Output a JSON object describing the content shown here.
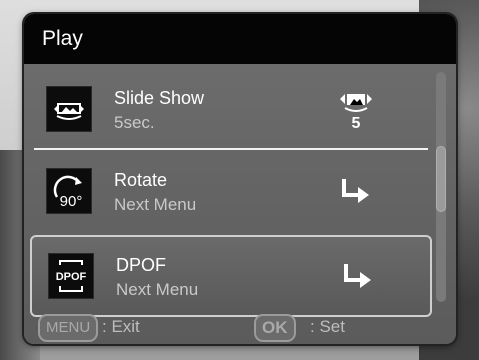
{
  "title": "Play",
  "items": [
    {
      "label": "Slide Show",
      "value": "5sec.",
      "icon": "slideshow-icon",
      "value_icon": "slideshow-interval-icon",
      "value_icon_text": "5"
    },
    {
      "label": "Rotate",
      "value": "Next Menu",
      "icon": "rotate-90-icon",
      "icon_text": "90°",
      "value_icon": "right-turn-arrow-icon"
    },
    {
      "label": "DPOF",
      "value": "Next Menu",
      "icon": "dpof-icon",
      "icon_text": "DPOF",
      "value_icon": "right-turn-arrow-icon",
      "selected": true
    }
  ],
  "footer": {
    "menu_key": "MENU",
    "menu_action": ": Exit",
    "ok_key": "OK",
    "ok_action": ": Set"
  },
  "colors": {
    "title_bar": "#050505",
    "panel": "#656565",
    "text": "#ffffff",
    "subtext": "#c9c9c9",
    "selection_border": "#cfcfcf"
  }
}
